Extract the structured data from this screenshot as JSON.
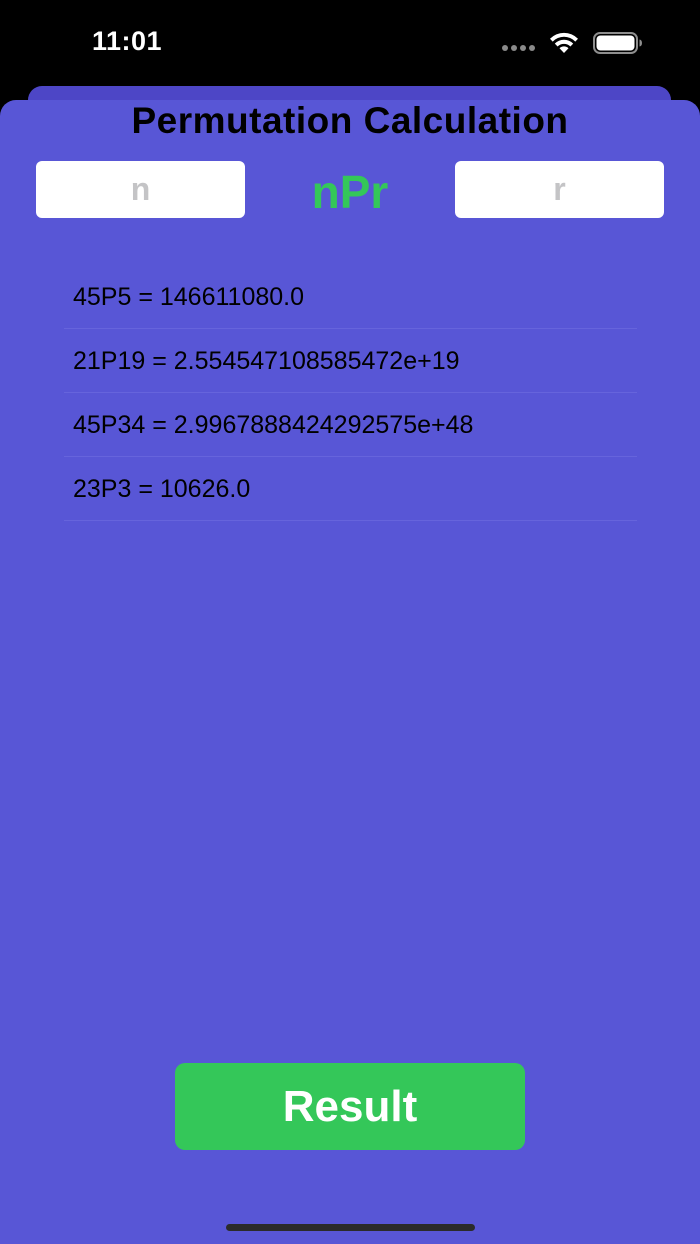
{
  "status_bar": {
    "time": "11:01"
  },
  "title": "Permutation Calculation",
  "inputs": {
    "n_placeholder": "n",
    "r_placeholder": "r",
    "n_value": "",
    "r_value": ""
  },
  "operator_label": "nPr",
  "history": [
    "45P5 = 146611080.0",
    "21P19 = 2.554547108585472e+19",
    "45P34 = 2.9967888424292575e+48",
    "23P3 = 10626.0"
  ],
  "result_button_label": "Result",
  "colors": {
    "background": "#5856d6",
    "accent_green": "#34c759",
    "text": "#000000"
  }
}
